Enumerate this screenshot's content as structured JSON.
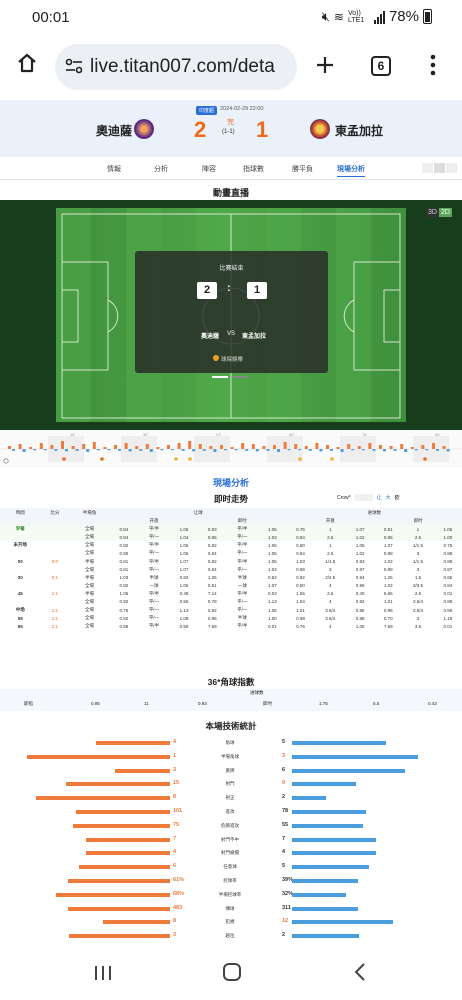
{
  "status": {
    "time": "00:01",
    "battery": "78%",
    "net": "Vo)) LTE1"
  },
  "browser": {
    "url": "live.titan007.com/deta",
    "tabs": "6"
  },
  "match": {
    "badge": "印度超",
    "datetime": "2024-02-29 22:00",
    "home": "奧迪薩",
    "away": "東孟加拉",
    "home_score": "2",
    "away_score": "1",
    "status": "完",
    "half": "(1-1)"
  },
  "tabs": [
    "情報",
    "分析",
    "陣容",
    "指球數",
    "勝平負",
    "現場分析"
  ],
  "live_anim": {
    "title": "動畫直播",
    "toggle": [
      "3D",
      "2D"
    ],
    "overlay_title": "比賽結束",
    "home_score": "2",
    "away_score": "1",
    "colon": ":",
    "home": "奧迪薩",
    "vs": "VS",
    "away": "東孟加拉",
    "brand": "球探娛樂"
  },
  "timeline_minutes": [
    "15'",
    "30'",
    "HT",
    "60'",
    "75'",
    "90'"
  ],
  "analysis": {
    "title": "現場分析",
    "odds_title": "即时走势",
    "provider": "Crow*",
    "chk": [
      "让",
      "大",
      "欧"
    ],
    "head": [
      "時間",
      "比分",
      "半場角",
      "让球",
      "",
      "进球数"
    ],
    "sub": [
      "开盘",
      "",
      "即时",
      "",
      "",
      "开盘",
      "",
      "即时"
    ],
    "rows": [
      [
        "早餐",
        "",
        "全場",
        "0.84",
        "平/半",
        "1.05",
        "0.83",
        "平/半",
        "1.05",
        "0.75",
        "1",
        "1.07",
        "0.81",
        "1",
        "1.05"
      ],
      [
        "",
        "",
        "全場",
        "0.84",
        "平/一",
        "1.04",
        "0.86",
        "平/一",
        "1.02",
        "0.84",
        "2.5",
        "1.02",
        "0.86",
        "2.5",
        "1.00"
      ],
      [
        "未开场",
        "",
        "全場",
        "0.82",
        "平/半",
        "1.06",
        "0.82",
        "平/半",
        "1.06",
        "0.80",
        "1",
        "1.06",
        "1.07",
        "1/1.5",
        "0.75"
      ],
      [
        "",
        "",
        "全場",
        "0.90",
        "平/一",
        "1.06",
        "0.84",
        "平/一",
        "1.05",
        "0.84",
        "2.5",
        "1.02",
        "0.98",
        "3",
        "0.88"
      ],
      [
        "00",
        "0:0",
        "半場",
        "0.81",
        "平/半",
        "1.07",
        "0.82",
        "平/半",
        "1.05",
        "1.03",
        "1/1.5",
        "0.83",
        "1.02",
        "1/1.5",
        "0.85"
      ],
      [
        "",
        "",
        "全場",
        "0.81",
        "平/一",
        "1.07",
        "0.84",
        "平/一",
        "1.04",
        "0.99",
        "3",
        "0.87",
        "0.99",
        "3",
        "0.87"
      ],
      [
        "30",
        "0:1",
        "半場",
        "1.03",
        "半球",
        "0.83",
        "1.06",
        "半球",
        "0.82",
        "0.92",
        "2/2.5",
        "0.94",
        "1.26",
        "1.5",
        "0.65"
      ],
      [
        "",
        "",
        "全場",
        "0.82",
        "一球",
        "1.05",
        "0.81",
        "一球",
        "1.07",
        "0.50",
        "4",
        "0.96",
        "1.02",
        "3/3.5",
        "0.84"
      ],
      [
        "45",
        "1:1",
        "半場",
        "1.06",
        "平/半",
        "0.48",
        "7.14",
        "平/半",
        "0.02",
        "1.65",
        "2.5",
        "0.40",
        "6.66",
        "2.5",
        "0.01"
      ],
      [
        "",
        "",
        "全場",
        "0.92",
        "平/一",
        "0.56",
        "0.78",
        "平/一",
        "1.13",
        "1.04",
        "4",
        "0.82",
        "1.01",
        "3.5/4",
        "0.85"
      ],
      [
        "中场",
        "1:1",
        "全場",
        "0.76",
        "平/一",
        "1.13",
        "0.82",
        "平/一",
        "1.06",
        "1.01",
        "3.5/4",
        "0.85",
        "0.98",
        "3.5/4",
        "0.86"
      ],
      [
        "59",
        "1:1",
        "全場",
        "0.82",
        "平/一",
        "1.08",
        "0.88",
        "半球",
        "1.00",
        "0.98",
        "3.5/4",
        "0.88",
        "0.70",
        "3",
        "1.19"
      ],
      [
        "95",
        "2:1",
        "全場",
        "0.85",
        "平/半",
        "0.59",
        "7.69",
        "平/半",
        "0.01",
        "0.76",
        "4",
        "1.06",
        "7.69",
        "3.5",
        "0.01"
      ]
    ]
  },
  "corner": {
    "title": "36*角球指數",
    "sub": "进球数",
    "row": [
      "即指",
      "0.95",
      "11",
      "0.93",
      "即时",
      "1.75",
      "5.5",
      "0.43"
    ]
  },
  "stats": {
    "title": "本場技術統計",
    "items": [
      {
        "label": "角球",
        "home": "4",
        "away": "5"
      },
      {
        "label": "半場角球",
        "home": "1",
        "away": "3"
      },
      {
        "label": "黃牌",
        "home": "3",
        "away": "6"
      },
      {
        "label": "射門",
        "home": "15",
        "away": "9"
      },
      {
        "label": "射正",
        "home": "8",
        "away": "2"
      },
      {
        "label": "進攻",
        "home": "101",
        "away": "78"
      },
      {
        "label": "危險進攻",
        "home": "75",
        "away": "55"
      },
      {
        "label": "射門不中",
        "home": "7",
        "away": "7"
      },
      {
        "label": "射門被擋",
        "home": "4",
        "away": "4"
      },
      {
        "label": "任意球",
        "home": "6",
        "away": "5"
      },
      {
        "label": "控球率",
        "home": "61%",
        "away": "39%"
      },
      {
        "label": "半場控球率",
        "home": "68%",
        "away": "32%"
      },
      {
        "label": "傳球",
        "home": "483",
        "away": "311"
      },
      {
        "label": "犯規",
        "home": "8",
        "away": "12"
      },
      {
        "label": "越位",
        "home": "3",
        "away": "2"
      }
    ],
    "home_frac": [
      0.44,
      0.85,
      0.33,
      0.62,
      0.8,
      0.56,
      0.58,
      0.5,
      0.5,
      0.54,
      0.61,
      0.68,
      0.61,
      0.4,
      0.6
    ],
    "away_frac": [
      0.56,
      0.75,
      0.67,
      0.38,
      0.2,
      0.44,
      0.42,
      0.5,
      0.5,
      0.46,
      0.39,
      0.32,
      0.39,
      0.6,
      0.4
    ]
  },
  "colors": {
    "accent": "#2a6fd6",
    "home_bar": "#ee7b3a",
    "away_bar": "#4a9ee0",
    "score": "#ee6a1a"
  }
}
